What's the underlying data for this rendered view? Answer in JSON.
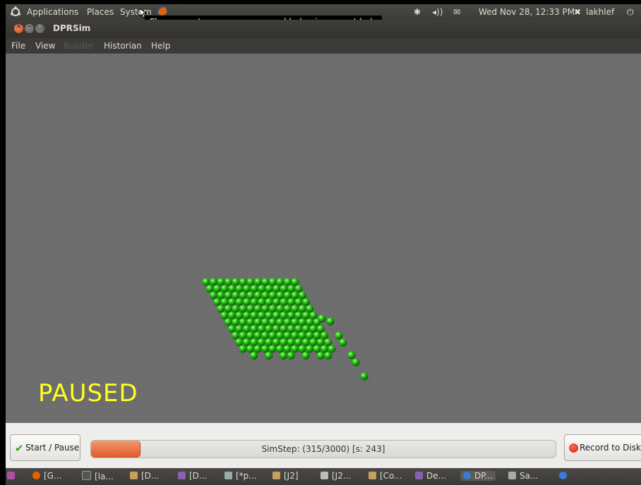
{
  "top_panel": {
    "menus": [
      "Applications",
      "Places",
      "System"
    ],
    "tooltip": "Change system appearance and behavior, or get help",
    "tray": {
      "datetime": "Wed Nov 28, 12:33 PM",
      "user": "lakhlef"
    },
    "icons": [
      "ubuntu-logo-icon",
      "firefox-icon",
      "bluetooth-icon",
      "volume-icon",
      "mail-icon",
      "user-icon",
      "power-icon"
    ]
  },
  "window": {
    "title": "DPRSim",
    "menubar": [
      "File",
      "View",
      "Builder",
      "Historian",
      "Help"
    ],
    "menubar_disabled": [
      "Builder"
    ]
  },
  "viewport": {
    "status_text": "PAUSED",
    "sphere_color": "#22cc10",
    "background_color": "#6d6d6d"
  },
  "controls": {
    "start_pause_label": "Start / Pause",
    "progress_text": "SimStep: (315/3000) [s: 243]",
    "progress_fraction": 0.105,
    "record_label": "Record to Disk",
    "accent_color": "#e0582a"
  },
  "taskbar": {
    "items": [
      "[G...",
      "[la...",
      "[D...",
      "[D...",
      "[*p...",
      "[J2]",
      "[J2...",
      "[Co...",
      "De...",
      "DP...",
      "Sa..."
    ]
  }
}
